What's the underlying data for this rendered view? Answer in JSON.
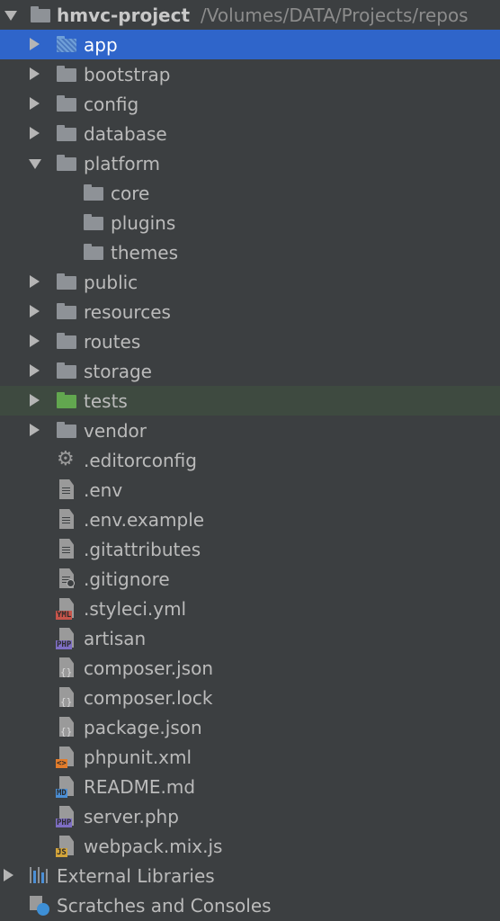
{
  "project": {
    "name": "hmvc-project",
    "path": "/Volumes/DATA/Projects/repos"
  },
  "items": [
    {
      "label": "app",
      "kind": "folder",
      "color": "blue",
      "expandable": true,
      "expanded": false,
      "depth": 1,
      "state": "selected"
    },
    {
      "label": "bootstrap",
      "kind": "folder",
      "expandable": true,
      "expanded": false,
      "depth": 1
    },
    {
      "label": "config",
      "kind": "folder",
      "expandable": true,
      "expanded": false,
      "depth": 1
    },
    {
      "label": "database",
      "kind": "folder",
      "expandable": true,
      "expanded": false,
      "depth": 1
    },
    {
      "label": "platform",
      "kind": "folder",
      "expandable": true,
      "expanded": true,
      "depth": 1
    },
    {
      "label": "core",
      "kind": "folder",
      "expandable": false,
      "depth": 2
    },
    {
      "label": "plugins",
      "kind": "folder",
      "expandable": false,
      "depth": 2
    },
    {
      "label": "themes",
      "kind": "folder",
      "expandable": false,
      "depth": 2
    },
    {
      "label": "public",
      "kind": "folder",
      "expandable": true,
      "expanded": false,
      "depth": 1
    },
    {
      "label": "resources",
      "kind": "folder",
      "expandable": true,
      "expanded": false,
      "depth": 1
    },
    {
      "label": "routes",
      "kind": "folder",
      "expandable": true,
      "expanded": false,
      "depth": 1
    },
    {
      "label": "storage",
      "kind": "folder",
      "expandable": true,
      "expanded": false,
      "depth": 1
    },
    {
      "label": "tests",
      "kind": "folder",
      "color": "green",
      "expandable": true,
      "expanded": false,
      "depth": 1,
      "state": "highlighted"
    },
    {
      "label": "vendor",
      "kind": "folder",
      "expandable": true,
      "expanded": false,
      "depth": 1
    },
    {
      "label": ".editorconfig",
      "kind": "config-file",
      "icon": "gear-icon",
      "depth": 1
    },
    {
      "label": ".env",
      "kind": "text-file",
      "icon": "text-file-icon",
      "depth": 1
    },
    {
      "label": ".env.example",
      "kind": "text-file",
      "icon": "text-file-icon",
      "depth": 1
    },
    {
      "label": ".gitattributes",
      "kind": "text-file",
      "icon": "text-file-icon",
      "depth": 1
    },
    {
      "label": ".gitignore",
      "kind": "ignore-file",
      "icon": "ignore-file-icon",
      "depth": 1
    },
    {
      "label": ".styleci.yml",
      "kind": "badge-file",
      "badge": "YML",
      "badge_color": "#c7544a",
      "icon": "yml-file-icon",
      "depth": 1
    },
    {
      "label": "artisan",
      "kind": "badge-file",
      "badge": "PHP",
      "badge_color": "#7e6ec4",
      "icon": "php-file-icon",
      "depth": 1
    },
    {
      "label": "composer.json",
      "kind": "json-file",
      "icon": "json-file-icon",
      "depth": 1
    },
    {
      "label": "composer.lock",
      "kind": "json-file",
      "icon": "json-file-icon",
      "depth": 1
    },
    {
      "label": "package.json",
      "kind": "json-file",
      "icon": "json-file-icon",
      "depth": 1
    },
    {
      "label": "phpunit.xml",
      "kind": "badge-file",
      "badge": "<>",
      "badge_color": "#e27c2b",
      "icon": "xml-file-icon",
      "depth": 1
    },
    {
      "label": "README.md",
      "kind": "badge-file",
      "badge": "MD",
      "badge_color": "#4b8fd6",
      "icon": "markdown-file-icon",
      "depth": 1
    },
    {
      "label": "server.php",
      "kind": "badge-file",
      "badge": "PHP",
      "badge_color": "#7e6ec4",
      "icon": "php-file-icon",
      "depth": 1
    },
    {
      "label": "webpack.mix.js",
      "kind": "badge-file",
      "badge": "JS",
      "badge_color": "#d4a53a",
      "icon": "js-file-icon",
      "depth": 1
    }
  ],
  "footer_items": [
    {
      "label": "External Libraries",
      "icon": "libraries-icon",
      "expandable": true
    },
    {
      "label": "Scratches and Consoles",
      "icon": "scratches-icon",
      "expandable": false
    }
  ],
  "colors": {
    "background": "#3c3f41",
    "selection": "#2f65ca",
    "highlight": "#3e4a40",
    "text": "#bbbbbb",
    "folder": "#8e9297",
    "folder_source": "#6f9fd8",
    "folder_test": "#62a74f"
  }
}
